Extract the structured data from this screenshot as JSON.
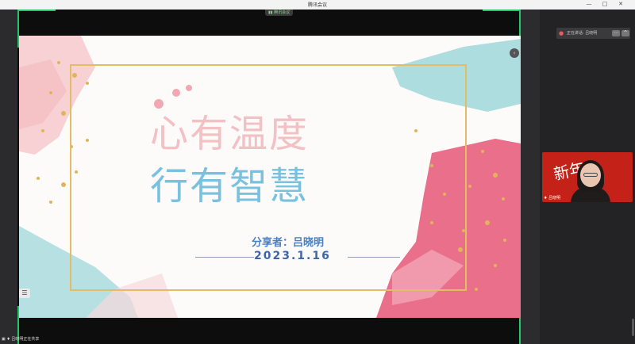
{
  "window": {
    "title": "腾讯会议",
    "minimize": "—",
    "maximize": "□",
    "close": "✕"
  },
  "meeting_pill": "▮▮ 腾讯会议",
  "slide": {
    "title_line1": "心有温度",
    "title_line2": "行有智慧",
    "presenter": "分享者：吕晓明",
    "date": "2023.1.16"
  },
  "speaking": {
    "label": "正在讲话: 吕晓明",
    "mic_icon": "mic-muted-icon",
    "expand_icon": "chevron-up-icon"
  },
  "participant": {
    "name": "吕晓明"
  },
  "bottom_status": {
    "text": "吕晓明正在共享"
  },
  "colors": {
    "share_border": "#21c66b",
    "title_pink": "#f3c0c4",
    "title_blue": "#79c1df",
    "frame_gold": "#e2bd66",
    "presenter_blue": "#4a80c4"
  }
}
